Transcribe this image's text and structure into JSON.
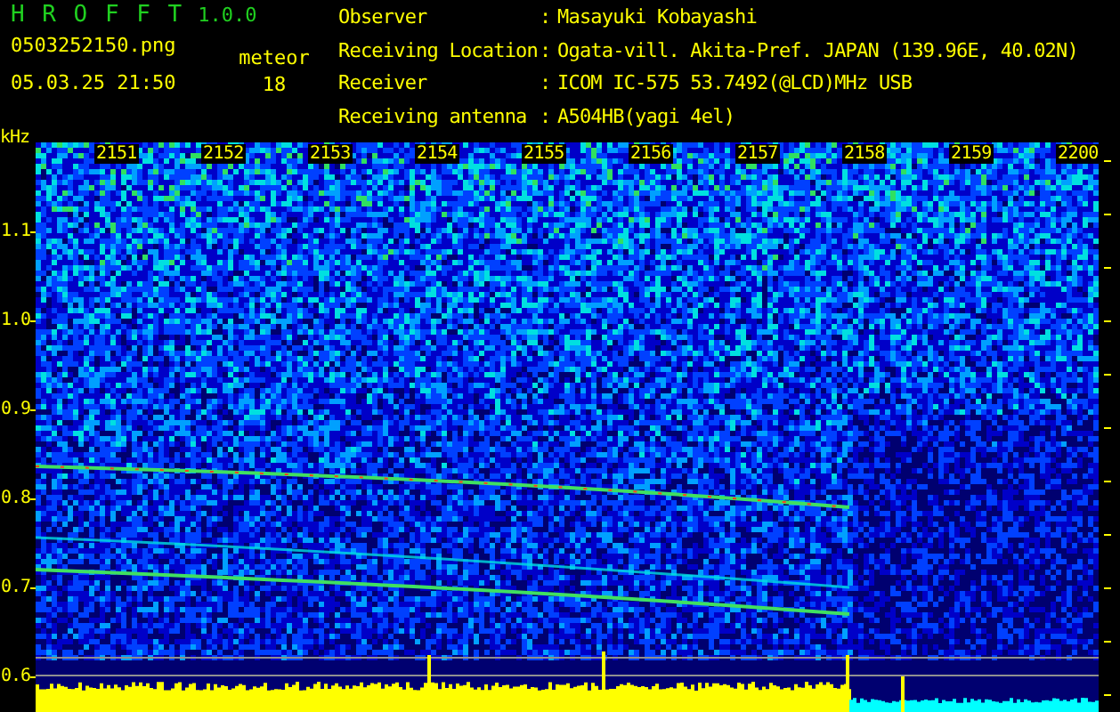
{
  "app": {
    "title": "H R O F F T",
    "version": "1.0.0"
  },
  "file": "0503252150.png",
  "datetime": "05.03.25 21:50",
  "meteor": {
    "label": "meteor",
    "count": "18"
  },
  "info": [
    {
      "label": "Observer",
      "separator": ":",
      "value": "Masayuki Kobayashi"
    },
    {
      "label": "Receiving Location",
      "separator": ":",
      "value": "Ogata-vill. Akita-Pref. JAPAN (139.96E, 40.02N)"
    },
    {
      "label": "Receiver",
      "separator": ":",
      "value": "ICOM IC-575 53.7492(@LCD)MHz USB"
    },
    {
      "label": "Receiving antenna",
      "separator": ":",
      "value": "A504HB(yagi 4el)"
    }
  ],
  "spectrogram": {
    "unit": "kHz",
    "y_labels": [
      "1.1",
      "1.0",
      "0.9",
      "0.8",
      "0.7",
      "0.6"
    ],
    "time_labels": [
      "2151",
      "2152",
      "2153",
      "2154",
      "2155",
      "2156",
      "2157",
      "2158",
      "2159",
      "2200"
    ]
  }
}
